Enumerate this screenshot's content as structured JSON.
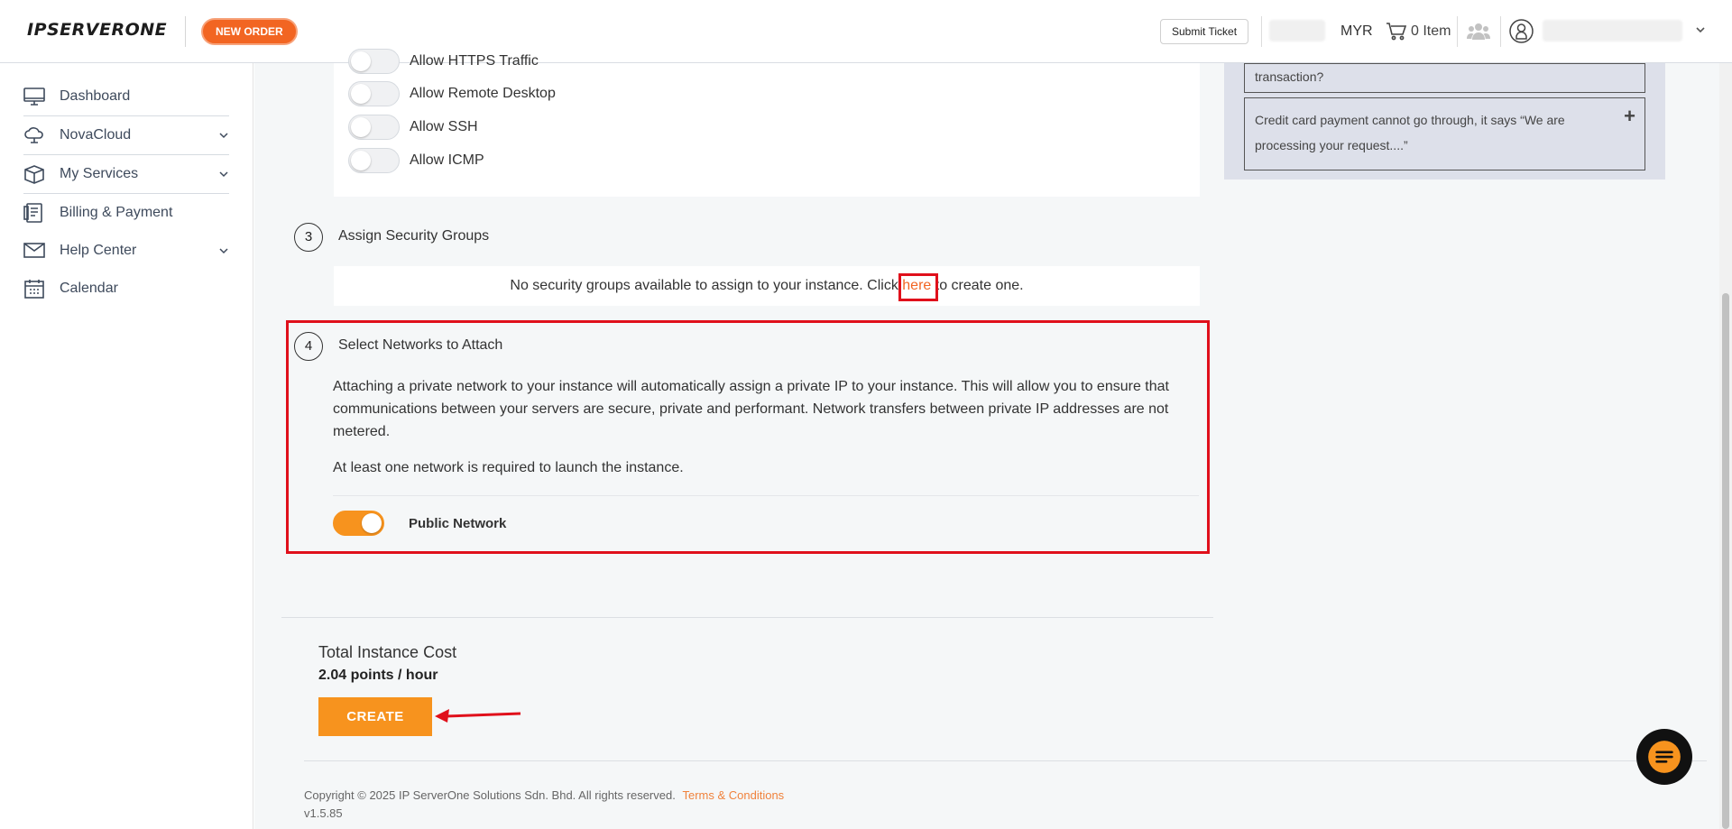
{
  "header": {
    "logo": "IPSERVERONE",
    "new_order": "NEW ORDER",
    "submit_ticket": "Submit Ticket",
    "currency": "MYR",
    "cart_count": "0 Item",
    "icons": [
      "cart-icon",
      "team-icon",
      "user-icon",
      "chevron-down-icon"
    ]
  },
  "sidebar": {
    "items": [
      {
        "label": "Dashboard",
        "icon": "monitor-icon",
        "has_chevron": false
      },
      {
        "label": "NovaCloud",
        "icon": "cloud-icon",
        "has_chevron": true
      },
      {
        "label": "My Services",
        "icon": "box-icon",
        "has_chevron": true
      },
      {
        "label": "Billing & Payment",
        "icon": "billing-icon",
        "has_chevron": false
      },
      {
        "label": "Help Center",
        "icon": "mail-icon",
        "has_chevron": true
      },
      {
        "label": "Calendar",
        "icon": "calendar-icon",
        "has_chevron": false
      }
    ]
  },
  "firewall": {
    "toggles": [
      {
        "label": "Allow HTTPS Traffic",
        "on": false
      },
      {
        "label": "Allow Remote Desktop",
        "on": false
      },
      {
        "label": "Allow SSH",
        "on": false
      },
      {
        "label": "Allow ICMP",
        "on": false
      }
    ]
  },
  "security_groups": {
    "step": "3",
    "title": "Assign Security Groups",
    "message_before": "No security groups available to assign to your instance. Click ",
    "link": "here",
    "message_after": " to create one."
  },
  "networks": {
    "step": "4",
    "title": "Select Networks to Attach",
    "description": "Attaching a private network to your instance will automatically assign a private IP to your instance. This will allow you to ensure that communications between your servers are secure, private and performant. Network transfers between private IP addresses are not metered.",
    "requirement": "At least one network is required to launch the instance.",
    "toggle_label": "Public Network",
    "toggle_on": true
  },
  "cost": {
    "label": "Total Instance Cost",
    "value": "2.04 points / hour",
    "create_button": "CREATE"
  },
  "faq": {
    "items": [
      {
        "text": "transaction?"
      },
      {
        "text": "Credit card payment cannot go through, it says “We are processing your request....”"
      }
    ]
  },
  "footer": {
    "copyright": "Copyright © 2025 IP ServerOne Solutions Sdn. Bhd. All rights reserved.",
    "terms": "Terms & Conditions",
    "version": "v1.5.85"
  },
  "colors": {
    "accent": "#f7931e",
    "new_order": "#f26522",
    "highlight": "#e0101b",
    "link": "#f26522",
    "faq_bg": "#dde0ea"
  }
}
